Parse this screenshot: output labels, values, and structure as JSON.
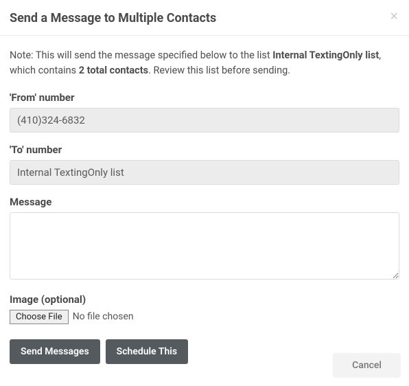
{
  "dialog": {
    "title": "Send a Message to Multiple Contacts",
    "note_prefix": "Note: This will send the message specified below to the list ",
    "list_name": "Internal TextingOnly list",
    "note_mid": ", which contains ",
    "contact_count": "2 total contacts",
    "note_suffix": ". Review this list before sending."
  },
  "fields": {
    "from_label": "'From' number",
    "from_value": "(410)324-6832",
    "to_label": "'To' number",
    "to_value": "Internal TextingOnly list",
    "message_label": "Message",
    "message_value": "",
    "image_label": "Image (optional)",
    "file_button": "Choose File",
    "file_status": "No file chosen"
  },
  "buttons": {
    "send": "Send Messages",
    "schedule": "Schedule This",
    "cancel": "Cancel"
  }
}
